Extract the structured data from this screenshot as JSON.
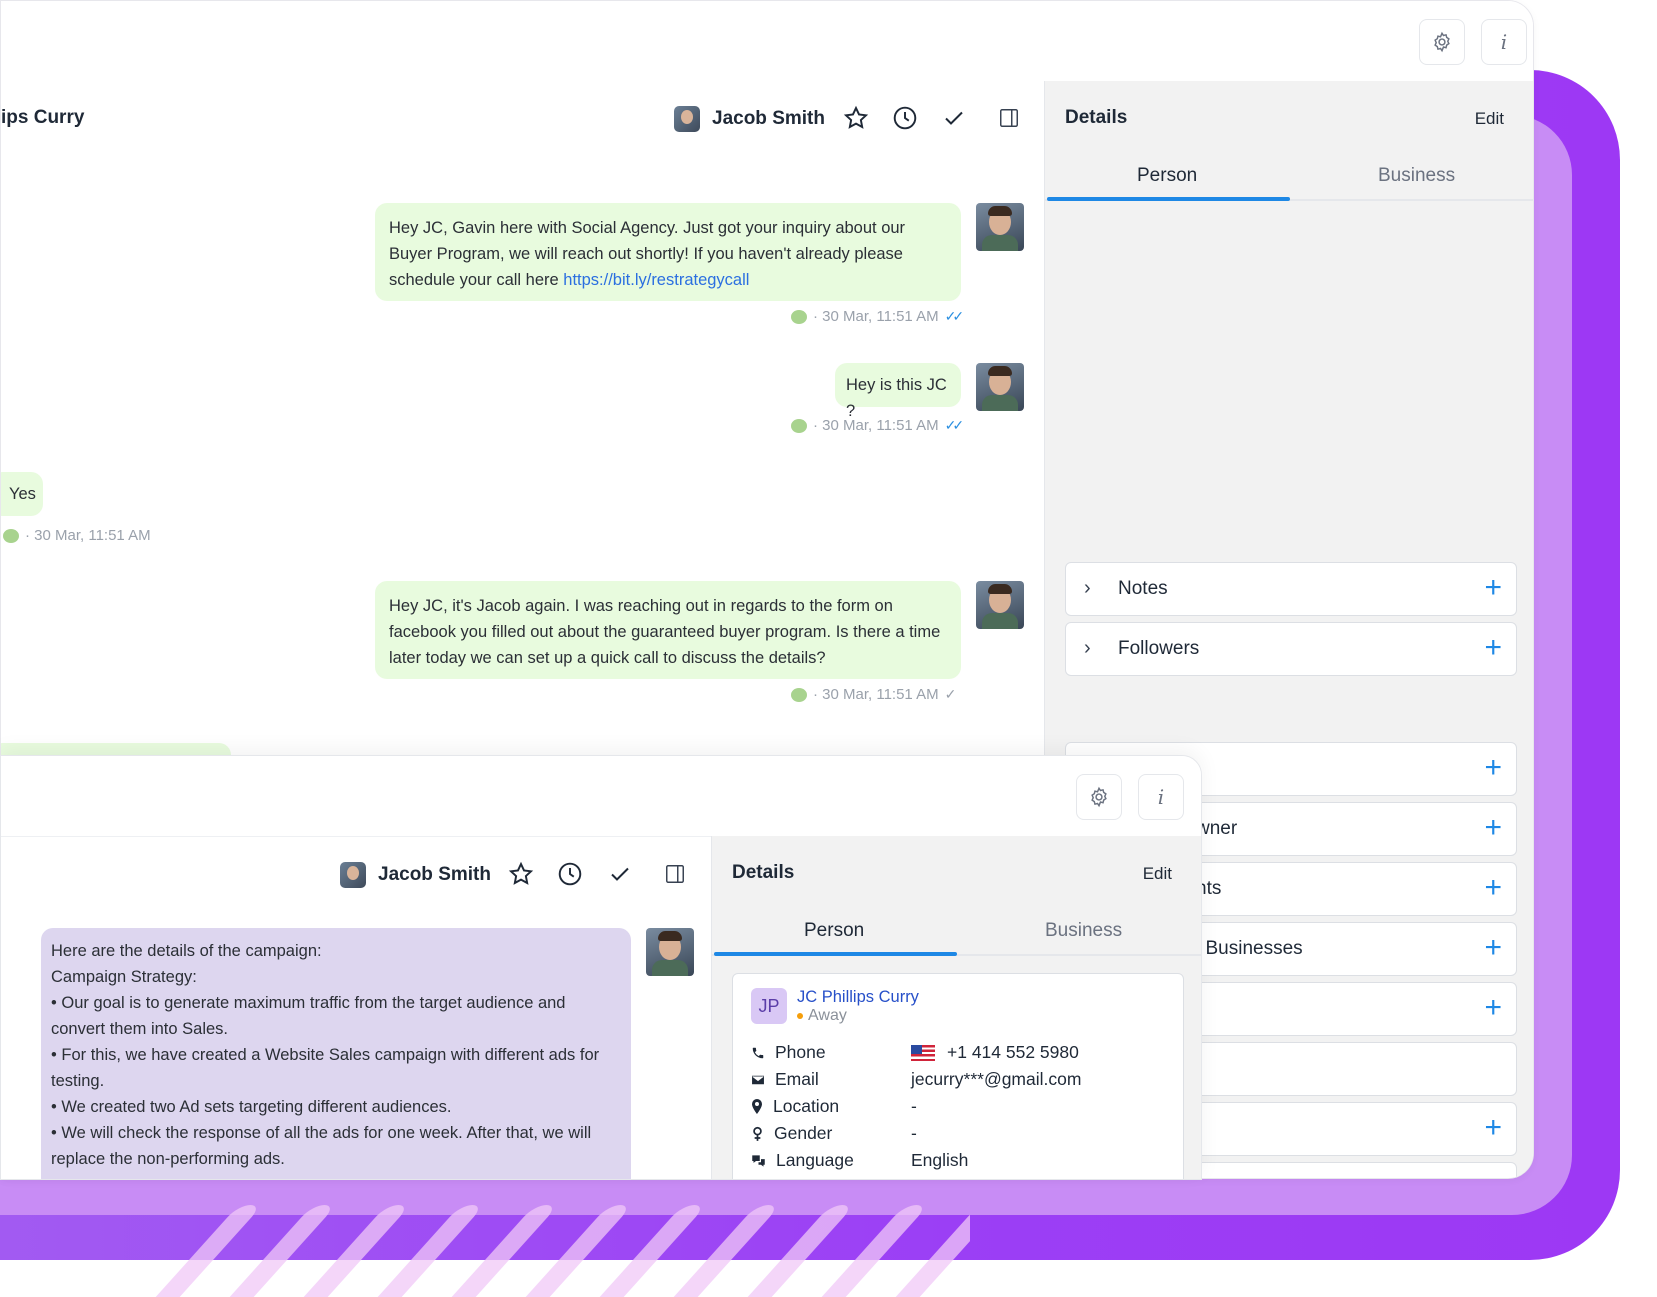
{
  "back_window": {
    "conversation_name": "ips Curry",
    "assignee_name": "Jacob Smith",
    "details": {
      "title": "Details",
      "edit_label": "Edit",
      "tabs": [
        "Person",
        "Business"
      ],
      "sections": [
        {
          "label": "Notes",
          "has_chevron": true,
          "has_plus": true
        },
        {
          "label": "Followers",
          "has_chevron": true,
          "has_plus": true
        },
        {
          "label": "",
          "has_plus": true
        },
        {
          "label": "wner",
          "has_plus": true
        },
        {
          "label": "nts",
          "has_plus": true
        },
        {
          "label": "l Businesses",
          "has_plus": true
        },
        {
          "label": "",
          "has_plus": true
        },
        {
          "label": "",
          "has_plus": false
        },
        {
          "label": "",
          "has_plus": true
        }
      ]
    },
    "messages": [
      {
        "direction": "out",
        "text": "Hey JC,  Gavin here with Social Agency. Just got your inquiry about our Buyer Program, we will reach out shortly! If you haven't already please schedule your call here",
        "link": "https://bit.ly/restrategycall",
        "meta": "· 30 Mar, 11:51 AM",
        "status": "read"
      },
      {
        "direction": "out",
        "text": "Hey is this JC ?",
        "meta": "· 30 Mar, 11:51 AM",
        "status": "read"
      },
      {
        "direction": "in",
        "text": "Yes",
        "meta": "· 30 Mar, 11:51 AM"
      },
      {
        "direction": "out",
        "text": "Hey JC, it's Jacob again. I was reaching out in regards to the form on facebook you filled out about the guaranteed buyer program. Is there a time later today we can set up a quick call to discuss the details?",
        "meta": "· 30 Mar, 11:51 AM",
        "status": "sent"
      }
    ]
  },
  "front_window": {
    "assignee_name": "Jacob Smith",
    "message_lines": [
      "Here are the details of the campaign:",
      "Campaign Strategy:",
      "• Our goal is to generate maximum traffic from the target audience and convert them into Sales.",
      "• For this, we have created a Website Sales campaign with different ads for testing.",
      "• We created two Ad sets targeting different audiences.",
      "• We will check the response of all the ads for one week. After that, we will replace the non-performing ads."
    ],
    "details": {
      "title": "Details",
      "edit_label": "Edit",
      "tabs": [
        "Person",
        "Business"
      ],
      "contact": {
        "initials": "JP",
        "name": "JC Phillips Curry",
        "status": "Away",
        "fields": [
          {
            "label": "Phone",
            "value": "+1 414 552 5980",
            "icon": "phone-icon"
          },
          {
            "label": "Email",
            "value": "jecurry***@gmail.com",
            "icon": "email-icon"
          },
          {
            "label": "Location",
            "value": "-",
            "icon": "location-pin-icon"
          },
          {
            "label": "Gender",
            "value": "-",
            "icon": "gender-icon"
          },
          {
            "label": "Language",
            "value": "English",
            "icon": "language-icon"
          }
        ]
      }
    }
  },
  "colors": {
    "accent_blue": "#1e88e5",
    "outgoing_bubble": "#e8fbde",
    "purple_bubble": "#ddd6ef",
    "backdrop_purple": "#9b3ff5",
    "status_away": "#f59e0b"
  }
}
